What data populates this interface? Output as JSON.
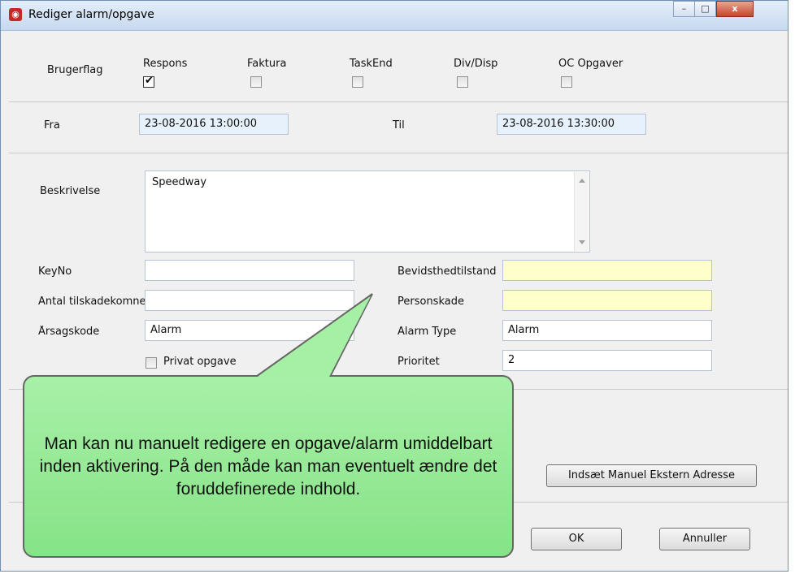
{
  "window": {
    "title": "Rediger alarm/opgave",
    "controls": {
      "minimize": "–",
      "maximize": "□",
      "close": "x"
    }
  },
  "flags": {
    "label": "Brugerflag",
    "items": [
      {
        "label": "Respons",
        "checked": true
      },
      {
        "label": "Faktura",
        "checked": false
      },
      {
        "label": "TaskEnd",
        "checked": false
      },
      {
        "label": "Div/Disp",
        "checked": false
      },
      {
        "label": "OC Opgaver",
        "checked": false
      }
    ]
  },
  "time": {
    "from_label": "Fra",
    "from_value": "23-08-2016 13:00:00",
    "to_label": "Til",
    "to_value": "23-08-2016 13:30:00"
  },
  "description": {
    "label": "Beskrivelse",
    "value": "Speedway"
  },
  "left_fields": {
    "keyno": {
      "label": "KeyNo",
      "value": ""
    },
    "antal": {
      "label": "Antal tilskadekomne",
      "value": ""
    },
    "aarsag": {
      "label": "Årsagskode",
      "value": "Alarm"
    },
    "privat": {
      "label": "Privat opgave",
      "checked": false
    }
  },
  "right_fields": {
    "bevidsthed": {
      "label": "Bevidsthedtilstand",
      "value": ""
    },
    "personskade": {
      "label": "Personskade",
      "value": ""
    },
    "alarm_type": {
      "label": "Alarm Type",
      "value": "Alarm"
    },
    "prioritet": {
      "label": "Prioritet",
      "value": "2"
    }
  },
  "buttons": {
    "manual_address": "Indsæt Manuel Ekstern Adresse",
    "ok": "OK",
    "cancel": "Annuller"
  },
  "callout": {
    "text": "Man kan nu manuelt redigere en opgave/alarm umiddelbart inden aktivering. På den måde kan man eventuelt ændre det foruddefinerede indhold."
  }
}
